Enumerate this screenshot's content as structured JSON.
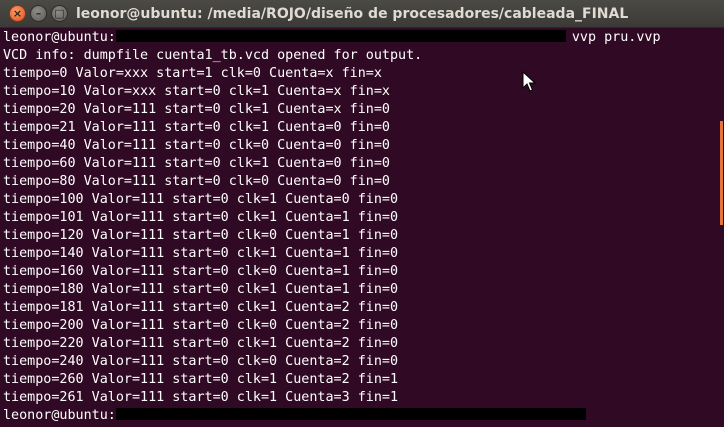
{
  "window": {
    "title": "leonor@ubuntu: /media/ROJO/diseño de procesadores/cableada_FINAL",
    "close_glyph": "×",
    "min_glyph": "–",
    "max_glyph": "□"
  },
  "terminal": {
    "prompt_user": "leonor@ubuntu:",
    "command": "vvp pru.vvp",
    "output_lines": [
      "VCD info: dumpfile cuenta1_tb.vcd opened for output.",
      "tiempo=0 Valor=xxx start=1 clk=0 Cuenta=x fin=x",
      "tiempo=10 Valor=xxx start=0 clk=1 Cuenta=x fin=x",
      "tiempo=20 Valor=111 start=0 clk=1 Cuenta=x fin=0",
      "tiempo=21 Valor=111 start=0 clk=1 Cuenta=0 fin=0",
      "tiempo=40 Valor=111 start=0 clk=0 Cuenta=0 fin=0",
      "tiempo=60 Valor=111 start=0 clk=1 Cuenta=0 fin=0",
      "tiempo=80 Valor=111 start=0 clk=0 Cuenta=0 fin=0",
      "tiempo=100 Valor=111 start=0 clk=1 Cuenta=0 fin=0",
      "tiempo=101 Valor=111 start=0 clk=1 Cuenta=1 fin=0",
      "tiempo=120 Valor=111 start=0 clk=0 Cuenta=1 fin=0",
      "tiempo=140 Valor=111 start=0 clk=1 Cuenta=1 fin=0",
      "tiempo=160 Valor=111 start=0 clk=0 Cuenta=1 fin=0",
      "tiempo=180 Valor=111 start=0 clk=1 Cuenta=1 fin=0",
      "tiempo=181 Valor=111 start=0 clk=1 Cuenta=2 fin=0",
      "tiempo=200 Valor=111 start=0 clk=0 Cuenta=2 fin=0",
      "tiempo=220 Valor=111 start=0 clk=1 Cuenta=2 fin=0",
      "tiempo=240 Valor=111 start=0 clk=0 Cuenta=2 fin=0",
      "tiempo=260 Valor=111 start=0 clk=1 Cuenta=2 fin=1",
      "tiempo=261 Valor=111 start=0 clk=1 Cuenta=3 fin=1"
    ],
    "last_prompt_user": "leonor@ubuntu:"
  },
  "colors": {
    "background": "#300a24",
    "text": "#ffffff",
    "scroll_thumb": "#e3733a"
  },
  "icons": [
    "close-icon",
    "minimize-icon",
    "maximize-icon",
    "mouse-pointer-icon"
  ]
}
